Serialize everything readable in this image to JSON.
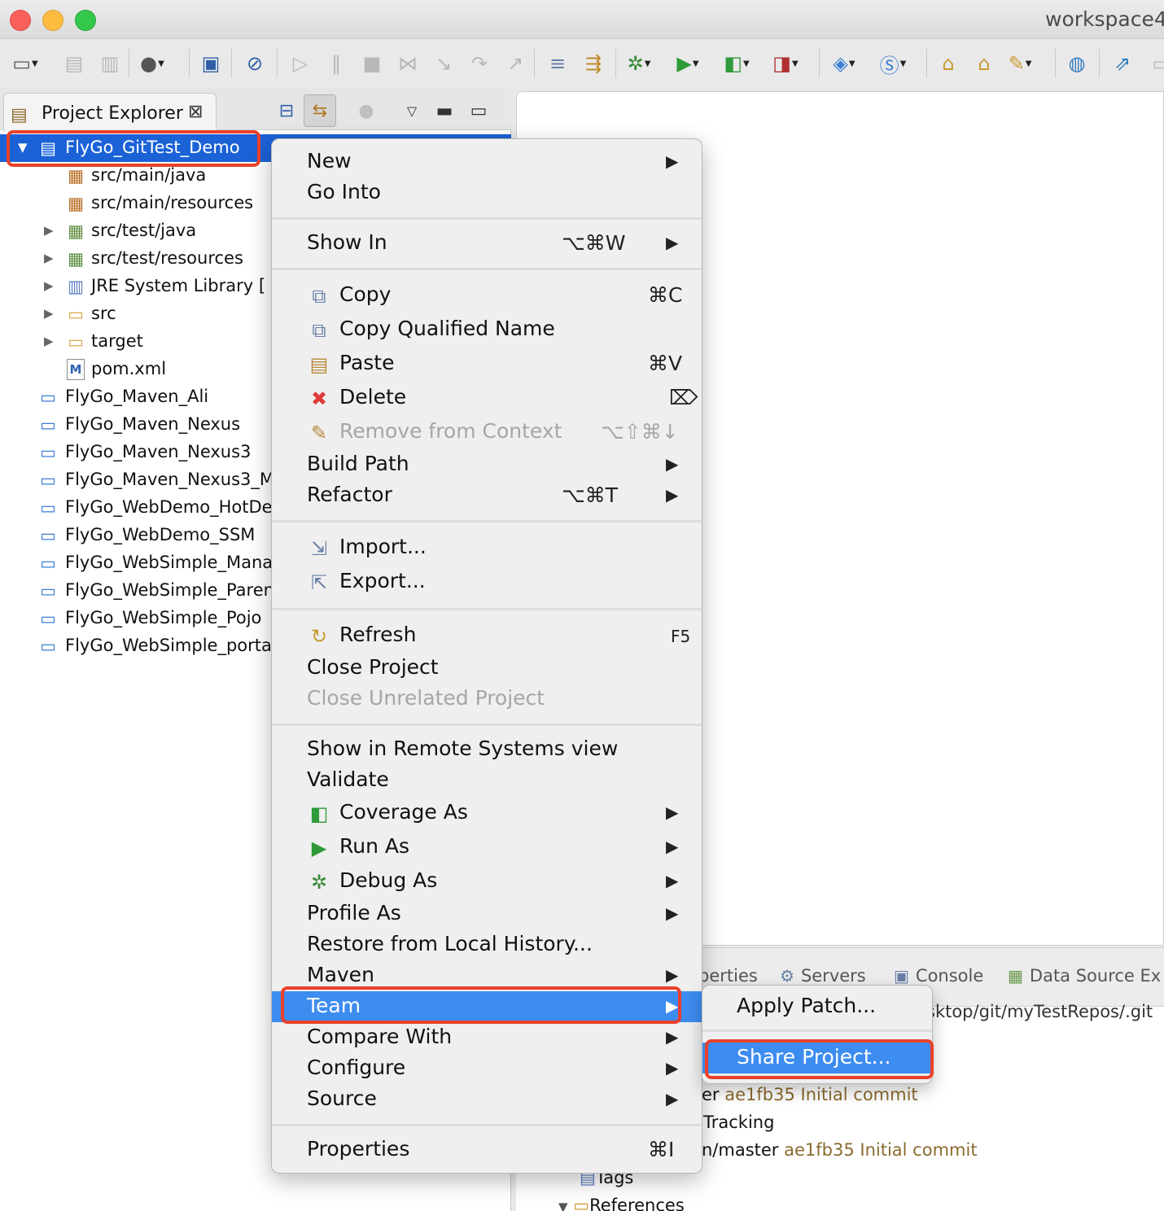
{
  "window": {
    "title": "workspace4"
  },
  "toolbar": {
    "icons": [
      "new-wizard-icon",
      "save-icon",
      "save-all-icon",
      "user-icon",
      "terminal-icon",
      "skip-breakpoints-icon",
      "resume-icon",
      "suspend-icon",
      "terminate-icon",
      "disconnect-icon",
      "step-into-icon",
      "step-over-icon",
      "step-return-icon",
      "drop-to-frame-icon",
      "use-step-filters-icon",
      "debug-icon",
      "run-icon",
      "coverage-icon",
      "external-tools-icon",
      "new-java-project-icon",
      "new-class-icon",
      "open-type-icon",
      "open-task-icon",
      "search-icon",
      "web-browser-icon",
      "perspective-icon"
    ]
  },
  "explorer": {
    "tab_label": "Project Explorer",
    "tree": [
      {
        "label": "FlyGo_GitTest_Demo",
        "type": "project-maven",
        "expanded": true
      },
      {
        "label": "src/main/java",
        "type": "package-root"
      },
      {
        "label": "src/main/resources",
        "type": "package-root"
      },
      {
        "label": "src/test/java",
        "type": "package-root"
      },
      {
        "label": "src/test/resources",
        "type": "package-root"
      },
      {
        "label": "JRE System Library [",
        "type": "library"
      },
      {
        "label": "src",
        "type": "folder"
      },
      {
        "label": "target",
        "type": "folder"
      },
      {
        "label": "pom.xml",
        "type": "xml-file",
        "icon_text": "M"
      },
      {
        "label": "FlyGo_Maven_Ali",
        "type": "project"
      },
      {
        "label": "FlyGo_Maven_Nexus",
        "type": "project"
      },
      {
        "label": "FlyGo_Maven_Nexus3",
        "type": "project"
      },
      {
        "label": "FlyGo_Maven_Nexus3_M",
        "type": "project"
      },
      {
        "label": "FlyGo_WebDemo_HotDe",
        "type": "project"
      },
      {
        "label": "FlyGo_WebDemo_SSM",
        "type": "project"
      },
      {
        "label": "FlyGo_WebSimple_Mana",
        "type": "project"
      },
      {
        "label": "FlyGo_WebSimple_Paren",
        "type": "project"
      },
      {
        "label": "FlyGo_WebSimple_Pojo",
        "type": "project"
      },
      {
        "label": "FlyGo_WebSimple_porta",
        "type": "project"
      }
    ]
  },
  "context_menu": {
    "items": [
      {
        "label": "New",
        "submenu": true
      },
      {
        "label": "Go Into"
      },
      {
        "label": "Show In",
        "shortcut": "⌥⌘W",
        "submenu": true
      },
      {
        "label": "Copy",
        "shortcut": "⌘C",
        "icon": "copy-icon"
      },
      {
        "label": "Copy Qualified Name",
        "icon": "copy-qualified-name-icon"
      },
      {
        "label": "Paste",
        "shortcut": "⌘V",
        "icon": "paste-icon"
      },
      {
        "label": "Delete",
        "shortcut": "⌦",
        "icon": "delete-icon"
      },
      {
        "label": "Remove from Context",
        "shortcut": "⌥⇧⌘↓",
        "icon": "remove-context-icon",
        "disabled": true
      },
      {
        "label": "Build Path",
        "submenu": true
      },
      {
        "label": "Refactor",
        "shortcut": "⌥⌘T",
        "submenu": true
      },
      {
        "label": "Import...",
        "icon": "import-icon"
      },
      {
        "label": "Export...",
        "icon": "export-icon"
      },
      {
        "label": "Refresh",
        "shortcut": "F5",
        "icon": "refresh-icon"
      },
      {
        "label": "Close Project"
      },
      {
        "label": "Close Unrelated Project",
        "disabled": true
      },
      {
        "label": "Show in Remote Systems view"
      },
      {
        "label": "Validate"
      },
      {
        "label": "Coverage As",
        "submenu": true,
        "icon": "coverage-icon"
      },
      {
        "label": "Run As",
        "submenu": true,
        "icon": "run-icon"
      },
      {
        "label": "Debug As",
        "submenu": true,
        "icon": "debug-icon"
      },
      {
        "label": "Profile As",
        "submenu": true
      },
      {
        "label": "Restore from Local History..."
      },
      {
        "label": "Maven",
        "submenu": true
      },
      {
        "label": "Team",
        "submenu": true,
        "active": true
      },
      {
        "label": "Compare With",
        "submenu": true
      },
      {
        "label": "Configure",
        "submenu": true
      },
      {
        "label": "Source",
        "submenu": true
      },
      {
        "label": "Properties",
        "shortcut": "⌘I"
      }
    ]
  },
  "team_submenu": {
    "items": [
      {
        "label": "Apply Patch..."
      },
      {
        "label": "Share Project...",
        "active": true
      }
    ]
  },
  "bottom_panel": {
    "tabs": [
      {
        "label": "perties",
        "icon": "properties-icon"
      },
      {
        "label": "Servers",
        "icon": "servers-icon"
      },
      {
        "label": "Console",
        "icon": "console-icon"
      },
      {
        "label": "Data Source Ex",
        "icon": "data-source-icon"
      }
    ],
    "repo_path": "sktop/git/myTestRepos/.git",
    "lines": [
      {
        "prefix": "er ",
        "commit": "ae1fb35 Initial commit"
      },
      {
        "prefix": "Tracking"
      },
      {
        "prefix": "n/master ",
        "commit": "ae1fb35 Initial commit"
      },
      {
        "prefix": "Tags"
      },
      {
        "prefix": "References"
      }
    ]
  },
  "colors": {
    "selection": "#1b62d7",
    "menu_highlight": "#3d8cf0",
    "annotation": "#e8412c",
    "commit_text": "#8b6b2e"
  }
}
